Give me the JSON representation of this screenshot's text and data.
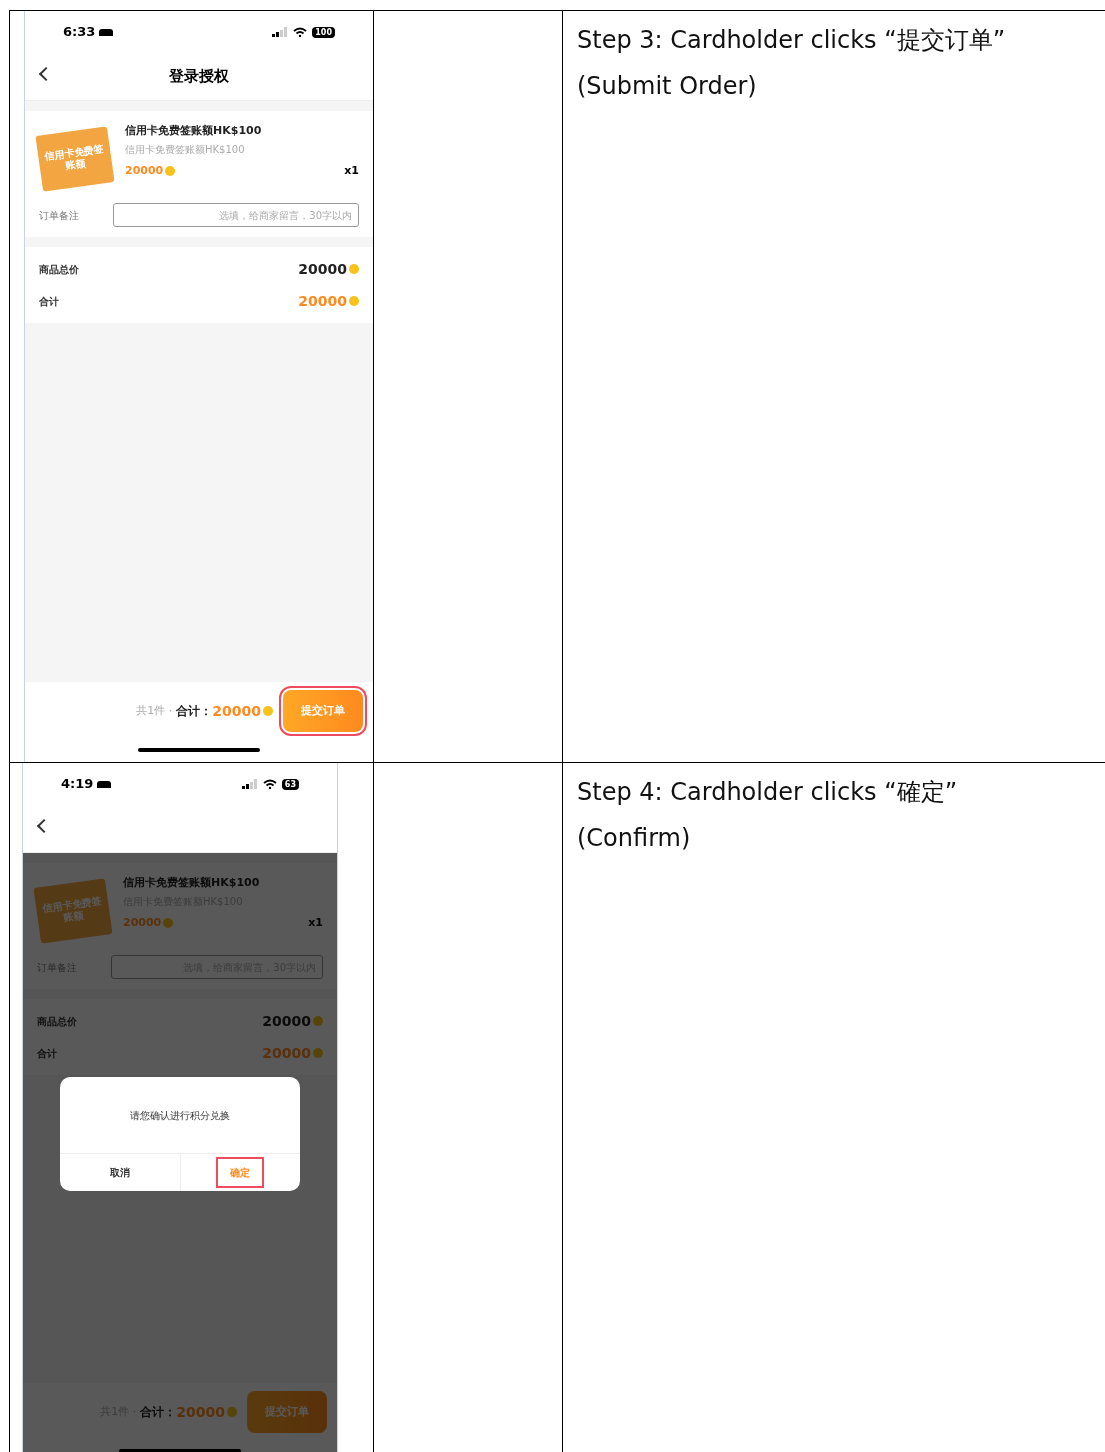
{
  "steps": [
    {
      "phone": {
        "time": "6:33",
        "battery": "100",
        "title": "登录授权",
        "product": {
          "image_text": "信用卡免费签账额",
          "name": "信用卡免费签账额HK$100",
          "subtitle": "信用卡免费签账额HK$100",
          "points": "20000",
          "quantity": "x1"
        },
        "note": {
          "label": "订单备注",
          "placeholder": "选填，给商家留言，30字以内"
        },
        "summary": [
          {
            "label": "商品总价",
            "value": "20000",
            "accent": false
          },
          {
            "label": "合计",
            "value": "20000",
            "accent": true
          }
        ],
        "footer": {
          "count": "共1件 ·",
          "total_label": "合计：",
          "total": "20000",
          "submit": "提交订单",
          "submit_highlighted": true
        },
        "dimmed": false
      },
      "description": "Step 3: Cardholder clicks “提交订单” (Submit Order)"
    },
    {
      "phone": {
        "time": "4:19",
        "battery": "63",
        "product": {
          "image_text": "信用卡免费签账额",
          "name": "信用卡免费签账额HK$100",
          "subtitle": "信用卡免费签账额HK$100",
          "points": "20000",
          "quantity": "x1"
        },
        "note": {
          "label": "订单备注",
          "placeholder": "选填，给商家留言，30字以内"
        },
        "summary": [
          {
            "label": "商品总价",
            "value": "20000",
            "accent": false
          },
          {
            "label": "合计",
            "value": "20000",
            "accent": true
          }
        ],
        "footer": {
          "count": "共1件 ·",
          "total_label": "合计：",
          "total": "20000",
          "submit": "提交订单",
          "submit_highlighted": false
        },
        "dimmed": true,
        "dialog": {
          "message": "请您确认进行积分兑换",
          "buttons": [
            {
              "label": "取消",
              "kind": "cancel",
              "highlighted": false
            },
            {
              "label": "确定",
              "kind": "confirm",
              "highlighted": true
            }
          ]
        }
      },
      "description": "Step 4: Cardholder clicks “確定” (Confirm)"
    }
  ]
}
